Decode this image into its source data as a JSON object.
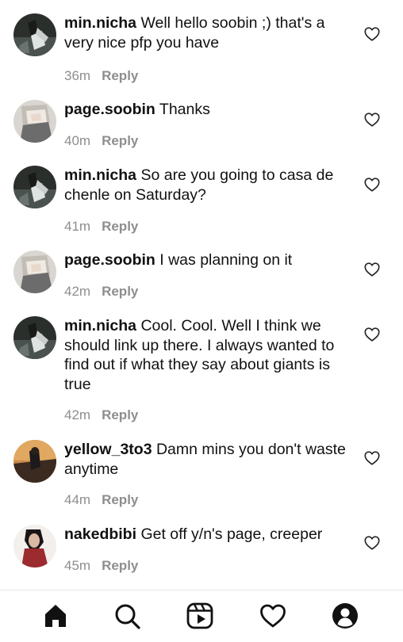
{
  "comments": [
    {
      "username": "min.nicha",
      "text": "Well hello soobin ;) that's a very nice pfp you have",
      "time": "36m",
      "reply": "Reply"
    },
    {
      "username": "page.soobin",
      "text": "Thanks",
      "time": "40m",
      "reply": "Reply"
    },
    {
      "username": "min.nicha",
      "text": "So are you going to casa de chenle on Saturday?",
      "time": "41m",
      "reply": "Reply"
    },
    {
      "username": "page.soobin",
      "text": "I was planning on it",
      "time": "42m",
      "reply": "Reply"
    },
    {
      "username": "min.nicha",
      "text": "Cool. Cool. Well I think we should link up there. I always wanted to find out if what they say about giants is true",
      "time": "42m",
      "reply": "Reply"
    },
    {
      "username": "yellow_3to3",
      "text": "Damn mins you don't waste anytime",
      "time": "44m",
      "reply": "Reply"
    },
    {
      "username": "nakedbibi",
      "text": "Get off y/n's page, creeper",
      "time": "45m",
      "reply": "Reply"
    }
  ],
  "navbar": {
    "items": [
      "home-icon",
      "search-icon",
      "reels-icon",
      "activity-heart-icon",
      "profile-icon"
    ]
  },
  "colors": {
    "text": "#111111",
    "meta": "#8e8e8e",
    "background": "#ffffff"
  }
}
